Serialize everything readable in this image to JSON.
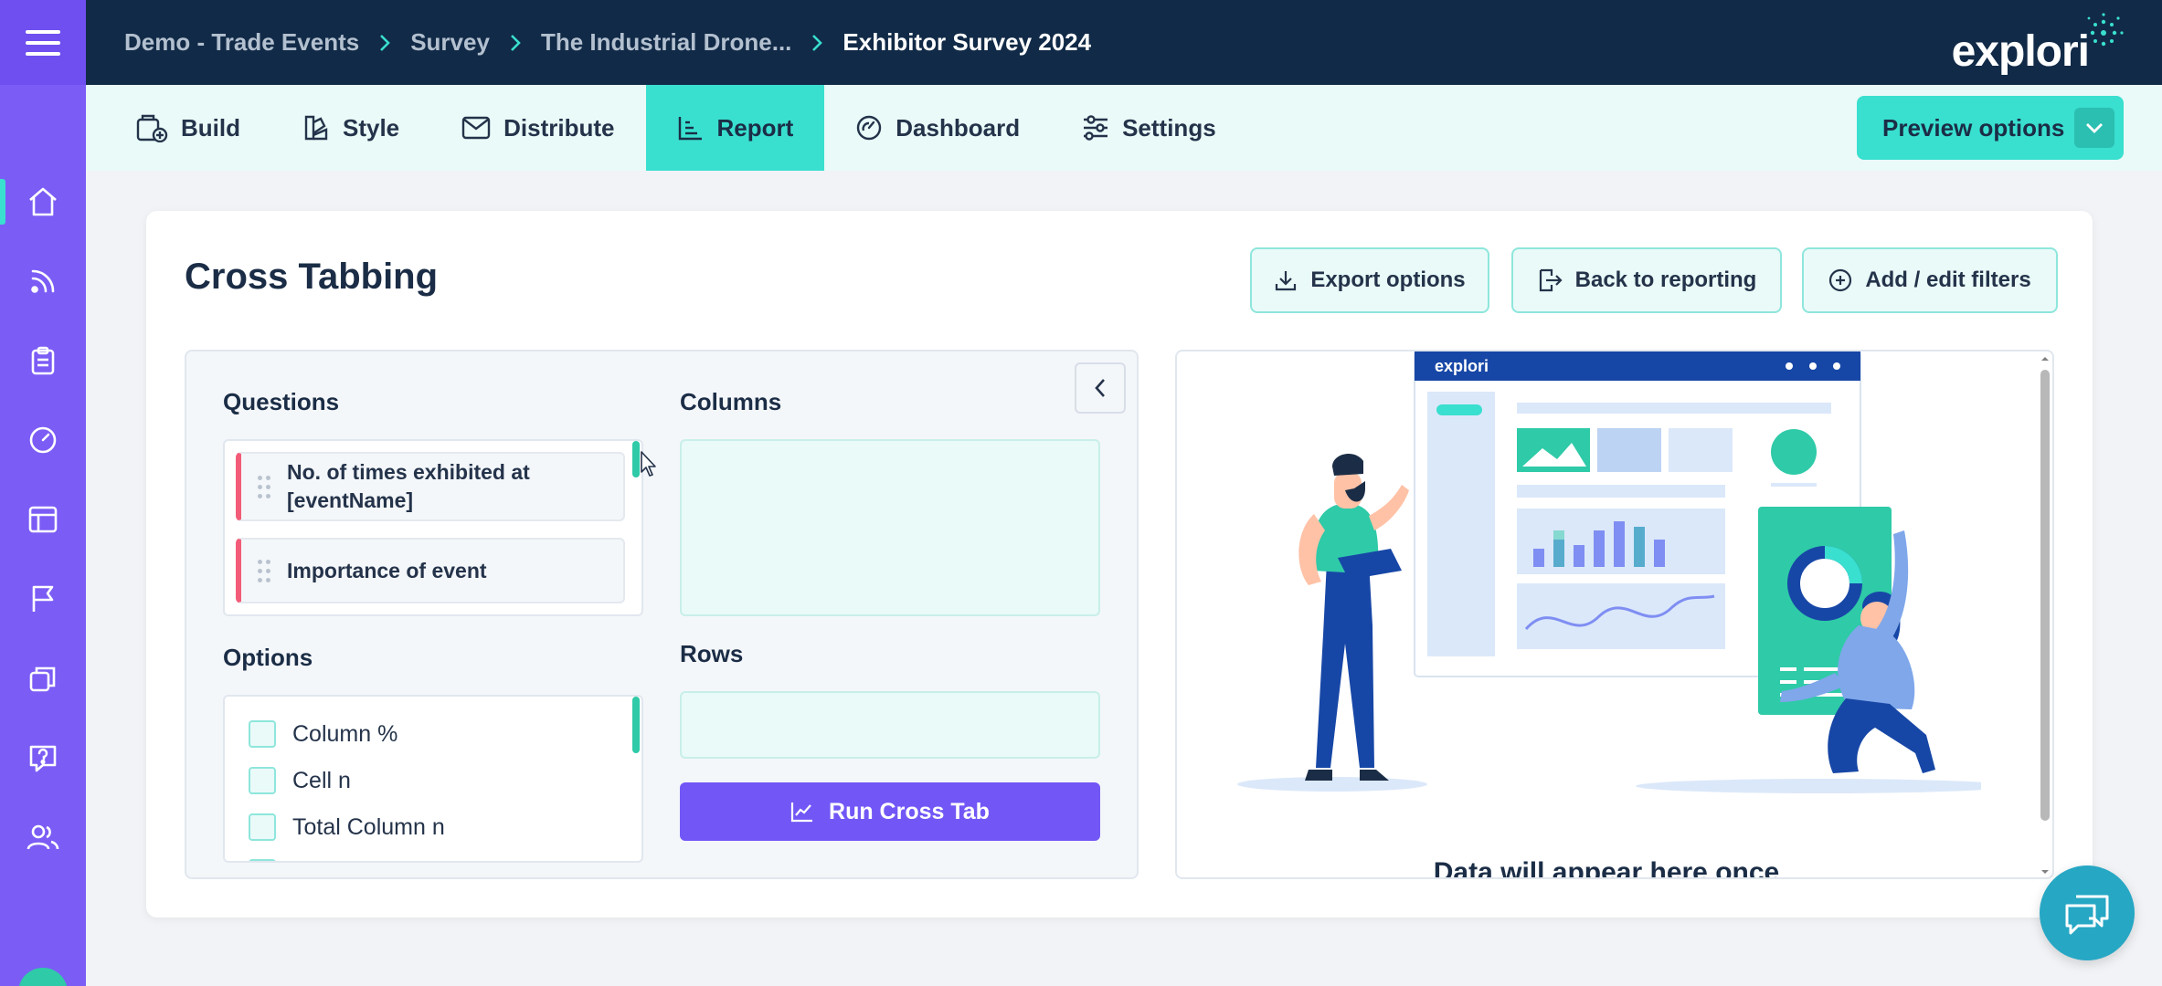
{
  "breadcrumbs": [
    {
      "label": "Demo - Trade Events"
    },
    {
      "label": "Survey"
    },
    {
      "label": "The Industrial Drone..."
    },
    {
      "label": "Exhibitor Survey 2024"
    }
  ],
  "logo": {
    "text": "explori"
  },
  "tabs": [
    {
      "label": "Build",
      "icon": "build-icon"
    },
    {
      "label": "Style",
      "icon": "style-icon"
    },
    {
      "label": "Distribute",
      "icon": "envelope-icon"
    },
    {
      "label": "Report",
      "icon": "report-chart-icon",
      "active": true
    },
    {
      "label": "Dashboard",
      "icon": "gauge-icon"
    },
    {
      "label": "Settings",
      "icon": "sliders-icon"
    }
  ],
  "preview": {
    "label": "Preview options"
  },
  "page": {
    "title": "Cross Tabbing",
    "export_label": "Export options",
    "back_label": "Back to reporting",
    "filters_label": "Add / edit filters"
  },
  "builder": {
    "questions_label": "Questions",
    "questions": [
      {
        "label": "No. of times exhibited at [eventName]"
      },
      {
        "label": "Importance of event"
      }
    ],
    "options_label": "Options",
    "options": [
      {
        "label": "Column %",
        "checked": false
      },
      {
        "label": "Cell n",
        "checked": false
      },
      {
        "label": "Total Column n",
        "checked": false
      }
    ],
    "columns_label": "Columns",
    "rows_label": "Rows",
    "run_label": "Run Cross Tab"
  },
  "result": {
    "illustration_logo": "explori",
    "message": "Data will appear here once"
  },
  "colors": {
    "rail": "#7b5cf5",
    "topbar": "#112a47",
    "accent": "#39dfcf",
    "run_button": "#7257f6",
    "question_marker": "#f25c78"
  }
}
